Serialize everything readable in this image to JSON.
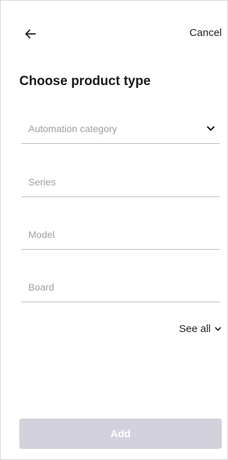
{
  "header": {
    "back_icon": "arrow-left-icon",
    "cancel_label": "Cancel"
  },
  "title": "Choose product type",
  "fields": [
    {
      "placeholder": "Automation category",
      "icon": "chevron-down-icon"
    },
    {
      "placeholder": "Series"
    },
    {
      "placeholder": "Model"
    },
    {
      "placeholder": "Board"
    }
  ],
  "see_all": {
    "label": "See all",
    "icon": "chevron-down-icon"
  },
  "add_button": {
    "label": "Add",
    "state": "disabled"
  },
  "colors": {
    "text": "#1a1a1a",
    "placeholder": "#9e9e9e",
    "underline": "#bdbdbd",
    "button_disabled": "#d3d1dc",
    "button_text": "#ffffff"
  }
}
